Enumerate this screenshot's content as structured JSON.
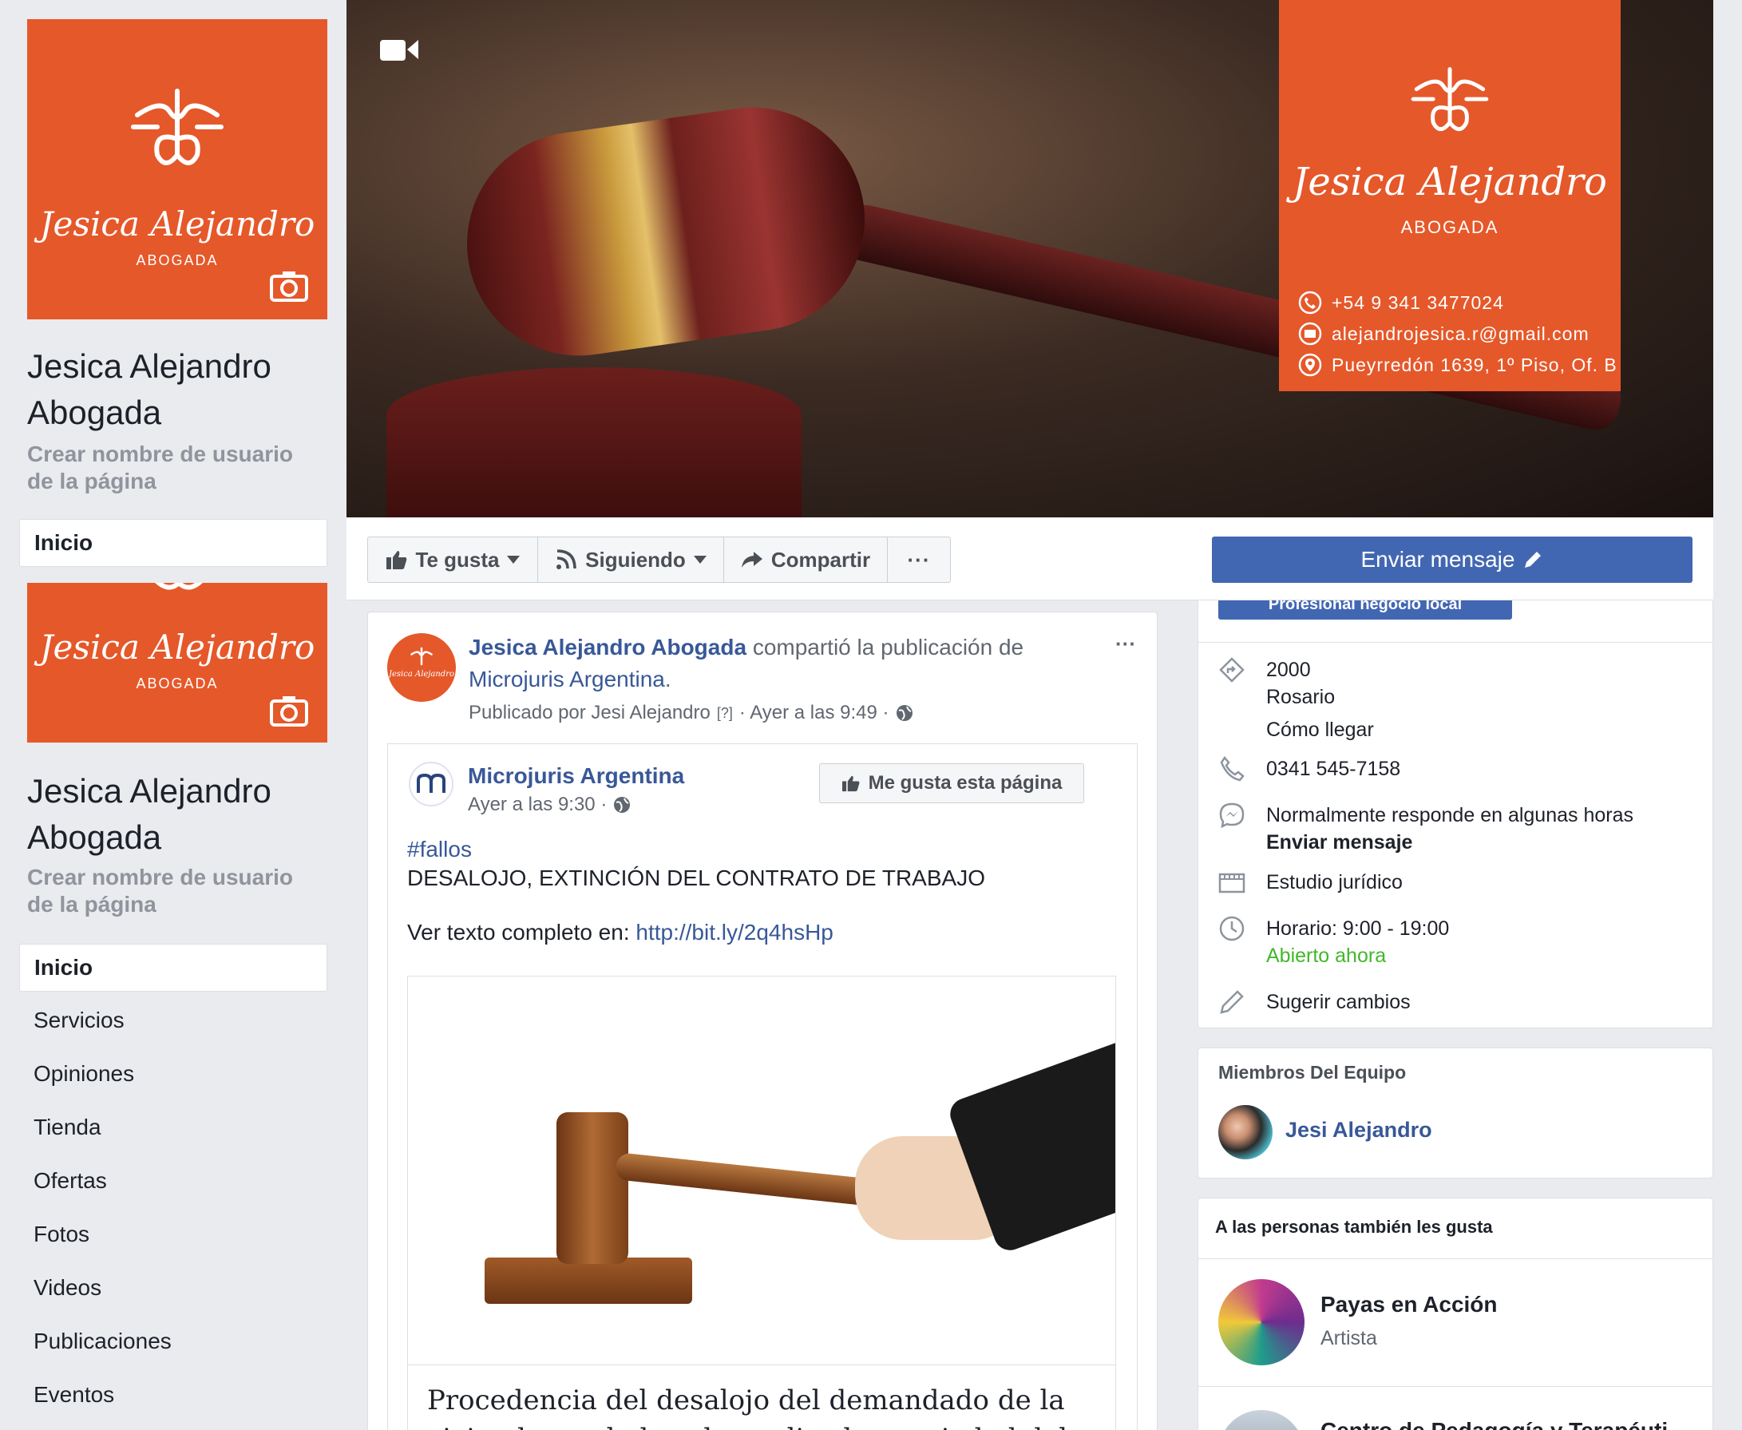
{
  "brand": {
    "name": "Jesica Alejandro",
    "title": "ABOGADA",
    "accent": "#e5582a"
  },
  "sidebar": {
    "page_name": "Jesica Alejandro Abogada",
    "username_prompt": "Crear nombre de usuario de la página",
    "active_item": "Inicio",
    "items": [
      "Servicios",
      "Opiniones",
      "Tienda",
      "Ofertas",
      "Fotos",
      "Videos",
      "Publicaciones",
      "Eventos"
    ]
  },
  "cover": {
    "phone": "+54 9 341 3477024",
    "email": "alejandrojesica.r@gmail.com",
    "address": "Pueyrredón 1639, 1º Piso, Of. B"
  },
  "actions": {
    "like": "Te gusta",
    "following": "Siguiendo",
    "share": "Compartir",
    "more": "···",
    "send_message": "Enviar mensaje"
  },
  "post": {
    "author": "Jesica Alejandro Abogada",
    "shared_text": "compartió la publicación de",
    "shared_from": "Microjuris Argentina",
    "period": ".",
    "published_by": "Publicado por Jesi Alejandro",
    "help": "[?]",
    "time": "· Ayer a las 9:49 ·",
    "more": "···",
    "inner": {
      "author": "Microjuris Argentina",
      "time": "Ayer a las 9:30 ·",
      "like_page": "Me gusta esta página",
      "hashtag": "#fallos",
      "line1": "DESALOJO, EXTINCIÓN DEL CONTRATO DE TRABAJO",
      "see_text": "Ver texto completo en:",
      "url": "http://bit.ly/2q4hsHp",
      "headline_line1": "Procedencia del desalojo del demandado de la",
      "headline_line2": "vivienda por haber de analizado propiedad del"
    }
  },
  "about": {
    "hidden_button": "Profesional negocio local",
    "postal": "2000",
    "city": "Rosario",
    "directions": "Cómo llegar",
    "phone": "0341 545-7158",
    "response": "Normalmente responde en algunas horas",
    "send_message": "Enviar mensaje",
    "category": "Estudio jurídico",
    "hours": "Horario: 9:00 - 19:00",
    "open_now": "Abierto ahora",
    "suggest": "Sugerir cambios"
  },
  "team": {
    "title": "Miembros Del Equipo",
    "member": "Jesi Alejandro"
  },
  "also_like": {
    "title": "A las personas también les gusta",
    "items": [
      {
        "name": "Payas en Acción",
        "category": "Artista"
      },
      {
        "name": "Centro de Pedagogía y Terapéuti",
        "category": ""
      }
    ]
  }
}
